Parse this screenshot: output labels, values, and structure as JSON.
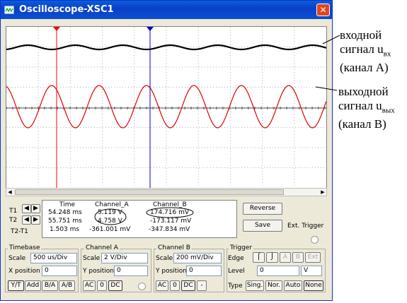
{
  "window": {
    "title": "Oscilloscope-XSC1",
    "close": "✕"
  },
  "cursors": {
    "headers": [
      "Time",
      "Channel_A",
      "Channel_B"
    ],
    "rows": [
      {
        "label": "T1",
        "time": "54.248 ms",
        "a": "5.119 V",
        "b": "174.716 mV"
      },
      {
        "label": "T2",
        "time": "55.751 ms",
        "a": "4.758 V",
        "b": "-173.117 mV"
      },
      {
        "label": "T2-T1",
        "time": "1.503 ms",
        "a": "-361.001 mV",
        "b": "-347.834 mV"
      }
    ]
  },
  "buttons": {
    "reverse": "Reverse",
    "save": "Save",
    "ext_trigger": "Ext. Trigger"
  },
  "timebase": {
    "title": "Timebase",
    "scale_label": "Scale",
    "scale": "500 us/Div",
    "xpos_label": "X position",
    "xpos": "0",
    "modes": [
      "Y/T",
      "Add",
      "B/A",
      "A/B"
    ]
  },
  "channel_a": {
    "title": "Channel A",
    "scale_label": "Scale",
    "scale": "2 V/Div",
    "ypos_label": "Y position",
    "ypos": "0",
    "coupling": [
      "AC",
      "0",
      "DC"
    ]
  },
  "channel_b": {
    "title": "Channel B",
    "scale_label": "Scale",
    "scale": "200 mV/Div",
    "ypos_label": "Y position",
    "ypos": "0",
    "coupling": [
      "AC",
      "0",
      "DC",
      "-"
    ]
  },
  "trigger": {
    "title": "Trigger",
    "edge_label": "Edge",
    "edge_btns": [
      "A",
      "B",
      "Ext"
    ],
    "level_label": "Level",
    "level": "0",
    "unit": "V",
    "type_label": "Type",
    "types": [
      "Sing.",
      "Nor.",
      "Auto",
      "None"
    ]
  },
  "annotations": {
    "input_l1": "входной",
    "input_l2": "сигнал u",
    "input_sub": "вх",
    "input_l3": "(канал А)",
    "output_l1": "выходной",
    "output_l2": "сигнал u",
    "output_sub": "вых",
    "output_l3": "(канал В)"
  },
  "colors": {
    "trace_a": "#000000",
    "trace_b": "#e00000",
    "cursor1": "#ff0000",
    "cursor2": "#0000cc",
    "title_bar": "#0a4fd0"
  }
}
